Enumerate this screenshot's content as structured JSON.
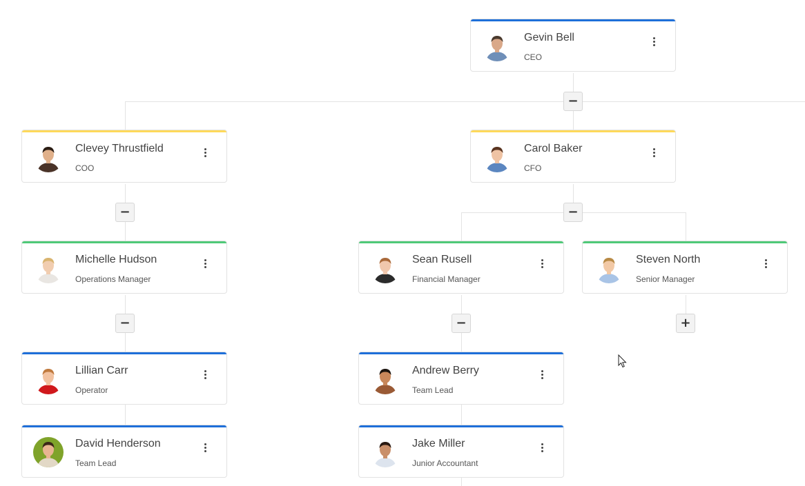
{
  "colors": {
    "blue": "#1e6fd9",
    "yellow": "#ffd95a",
    "green": "#4fc978",
    "connector": "#e3e3e3"
  },
  "nodes": [
    {
      "id": "gevin",
      "name": "Gevin Bell",
      "title": "CEO",
      "color": "#1e6fd9",
      "avatar": {
        "skin": "#d9a889",
        "hair": "#4a3a2e",
        "shirt": "#6f8fb8"
      }
    },
    {
      "id": "clevey",
      "name": "Clevey Thrustfield",
      "title": "COO",
      "color": "#ffd95a",
      "avatar": {
        "skin": "#e0b08a",
        "hair": "#2b1d14",
        "shirt": "#4a3328"
      }
    },
    {
      "id": "carol",
      "name": "Carol Baker",
      "title": "CFO",
      "color": "#ffd95a",
      "avatar": {
        "skin": "#efc3a4",
        "hair": "#5a3420",
        "shirt": "#5b86c0"
      }
    },
    {
      "id": "michelle",
      "name": "Michelle Hudson",
      "title": "Operations Manager",
      "color": "#4fc978",
      "avatar": {
        "skin": "#f1cdb0",
        "hair": "#d9b46f",
        "shirt": "#e9e6e2"
      }
    },
    {
      "id": "sean",
      "name": "Sean Rusell",
      "title": "Financial Manager",
      "color": "#4fc978",
      "avatar": {
        "skin": "#f0c7ad",
        "hair": "#a9693a",
        "shirt": "#2b2b2b"
      }
    },
    {
      "id": "steven",
      "name": "Steven North",
      "title": "Senior Manager",
      "color": "#4fc978",
      "avatar": {
        "skin": "#f2c9a6",
        "hair": "#b88a45",
        "shirt": "#a9c4e6"
      }
    },
    {
      "id": "lillian",
      "name": "Lillian Carr",
      "title": "Operator",
      "color": "#1e6fd9",
      "avatar": {
        "skin": "#f2c2a0",
        "hair": "#c07a3e",
        "shirt": "#d0181c"
      }
    },
    {
      "id": "andrew",
      "name": "Andrew Berry",
      "title": "Team Lead",
      "color": "#1e6fd9",
      "avatar": {
        "skin": "#c8875a",
        "hair": "#1b140f",
        "shirt": "#9a5a35"
      }
    },
    {
      "id": "david",
      "name": "David Henderson",
      "title": "Team Lead",
      "color": "#1e6fd9",
      "avatar": {
        "skin": "#e8b591",
        "hair": "#3b2718",
        "shirt": "#e2d8c6",
        "bg": "#7fa32a"
      }
    },
    {
      "id": "jake",
      "name": "Jake Miller",
      "title": "Junior Accountant",
      "color": "#1e6fd9",
      "avatar": {
        "skin": "#c98f6a",
        "hair": "#2a1a12",
        "shirt": "#dde4ee"
      }
    }
  ],
  "toggles": [
    {
      "id": "gevin",
      "symbol": "−",
      "state": "expanded"
    },
    {
      "id": "clevey",
      "symbol": "−",
      "state": "expanded"
    },
    {
      "id": "carol",
      "symbol": "−",
      "state": "expanded"
    },
    {
      "id": "michelle",
      "symbol": "−",
      "state": "expanded"
    },
    {
      "id": "sean",
      "symbol": "−",
      "state": "expanded"
    },
    {
      "id": "steven",
      "symbol": "+",
      "state": "collapsed"
    }
  ]
}
